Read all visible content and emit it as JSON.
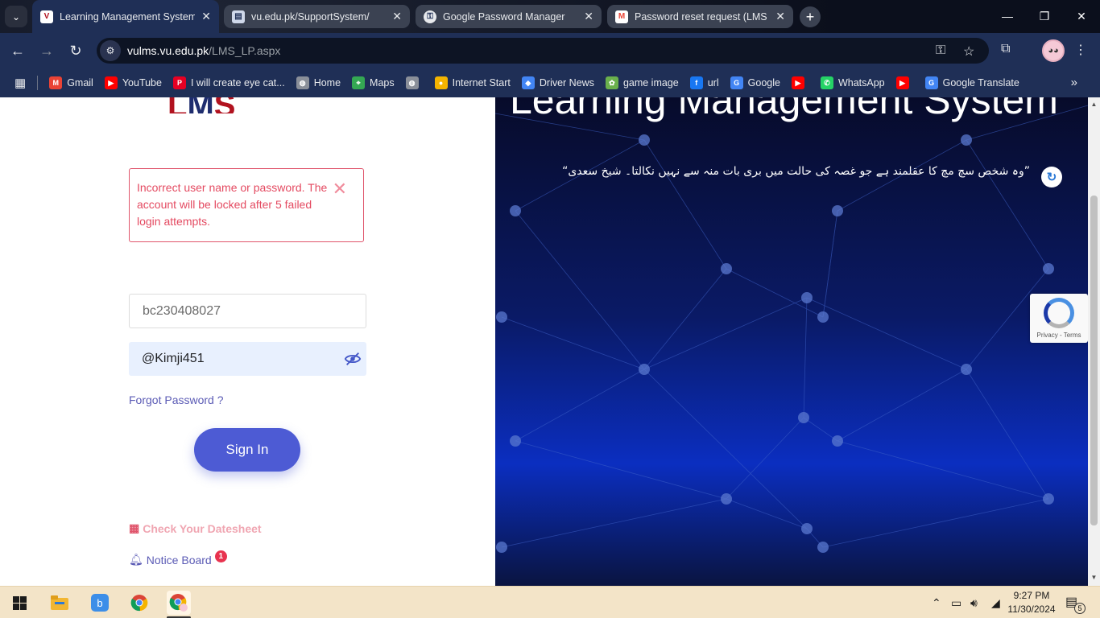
{
  "browser": {
    "tabs": [
      {
        "label": "Learning Management System",
        "favicon": "VU",
        "active": true
      },
      {
        "label": "vu.edu.pk/SupportSystem/",
        "favicon": "doc",
        "active": false
      },
      {
        "label": "Google Password Manager",
        "favicon": "key",
        "active": false
      },
      {
        "label": "Password reset request (LMS Pa",
        "favicon": "M",
        "active": false
      }
    ],
    "address": {
      "domain": "vulms.vu.edu.pk",
      "path": "/LMS_LP.aspx"
    },
    "bookmarks": [
      {
        "label": "Gmail",
        "icon": "gmail-icon",
        "color": "#ea4335"
      },
      {
        "label": "YouTube",
        "icon": "youtube-icon",
        "color": "#ff0000"
      },
      {
        "label": "I will create eye cat...",
        "icon": "pinterest-icon",
        "color": "#e60023"
      },
      {
        "label": "Home",
        "icon": "globe-icon",
        "color": "#8a8f99"
      },
      {
        "label": "Maps",
        "icon": "maps-icon",
        "color": "#34a853"
      },
      {
        "label": "",
        "icon": "globe-icon",
        "color": "#8a8f99"
      },
      {
        "label": "Internet Start",
        "icon": "internet-start-icon",
        "color": "#f4b400"
      },
      {
        "label": "Driver News",
        "icon": "driver-news-icon",
        "color": "#4285f4"
      },
      {
        "label": "game image",
        "icon": "game-image-icon",
        "color": "#6ab04c"
      },
      {
        "label": "url",
        "icon": "facebook-icon",
        "color": "#1877f2"
      },
      {
        "label": "Google",
        "icon": "google-icon",
        "color": "#4285f4"
      },
      {
        "label": "",
        "icon": "youtube-icon",
        "color": "#ff0000"
      },
      {
        "label": "WhatsApp",
        "icon": "whatsapp-icon",
        "color": "#25d366"
      },
      {
        "label": "",
        "icon": "youtube-icon",
        "color": "#ff0000"
      },
      {
        "label": "Google Translate",
        "icon": "translate-icon",
        "color": "#4285f4"
      }
    ]
  },
  "login": {
    "error_message": "Incorrect user name or password. The account will be locked after 5 failed login attempts.",
    "username_value": "bc230408027",
    "password_value": "@Kimji451",
    "forgot_label": "Forgot Password ?",
    "signin_label": "Sign In",
    "datesheet_label": "Check Your Datesheet",
    "notice_label": "Notice Board",
    "notice_count": "1"
  },
  "hero": {
    "title": "Learning Management System",
    "quote": "”وہ شخص سچ مچ کا عقلمند ہے جو غصہ کی حالت میں بری بات منہ سے نہیں نکالتا۔ شیخ سعدی“"
  },
  "recaptcha": {
    "terms": "Privacy - Terms"
  },
  "taskbar": {
    "time": "9:27 PM",
    "date": "11/30/2024",
    "notification_count": "5"
  },
  "colors": {
    "browser_frame": "#1f2f56",
    "error": "#e44a61",
    "signin_button": "#4d5bd4",
    "link": "#5b5bb5",
    "taskbar": "#f3e4c8"
  }
}
